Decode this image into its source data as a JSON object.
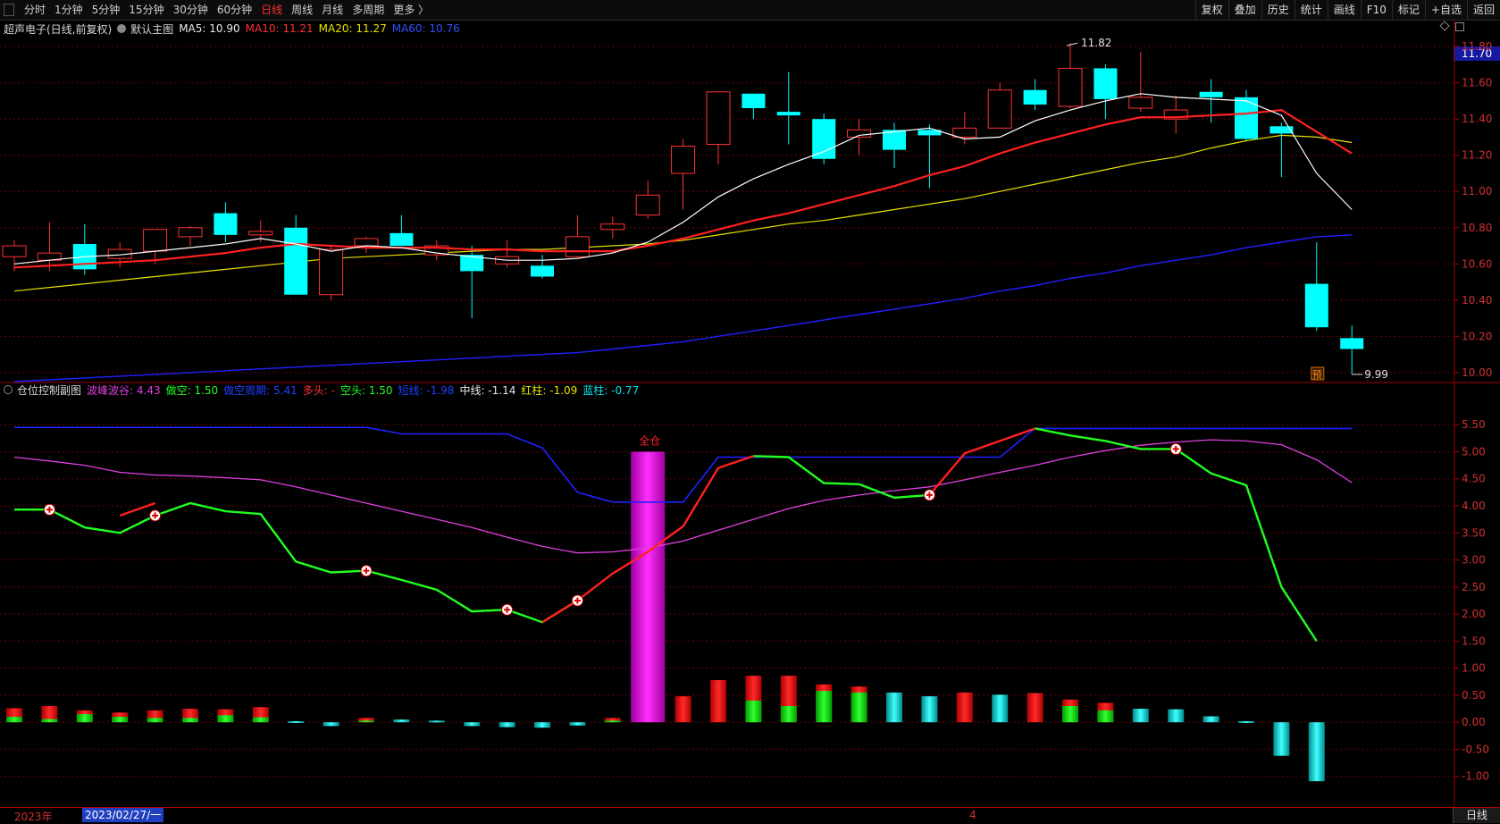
{
  "toolbar": {
    "periods": [
      "分时",
      "1分钟",
      "5分钟",
      "15分钟",
      "30分钟",
      "60分钟",
      "日线",
      "周线",
      "月线",
      "多周期",
      "更多 〉"
    ],
    "active_period": "日线",
    "right_menu": [
      "复权",
      "叠加",
      "历史",
      "统计",
      "画线",
      "F10",
      "标记",
      "+自选",
      "返回"
    ]
  },
  "main_legend": {
    "title": "超声电子(日线,前复权)",
    "template": "默认主图",
    "ma5": "MA5: 10.90",
    "ma10": "MA10: 11.21",
    "ma20": "MA20: 11.27",
    "ma60": "MA60: 10.76"
  },
  "sub_legend": {
    "title": "仓位控制副图",
    "bofeng": "波峰波谷: 4.43",
    "zuokong": "做空: 1.50",
    "zuokong_zhouqi": "做空周期: 5.41",
    "duotou": "多头: -",
    "kongtou": "空头: 1.50",
    "duanxian": "短线: -1.98",
    "zhongxian": "中线: -1.14",
    "hongzhu": "红柱: -1.09",
    "lanzhu": "蓝柱: -0.77"
  },
  "current_price": "11.70",
  "bottom": {
    "year": "2023年",
    "date": "2023/02/27/一",
    "month_mark": "4",
    "period": "日线"
  },
  "colors": {
    "up": "#ff3232",
    "down": "#00ffff",
    "ma5": "#ffffff",
    "ma10": "#ff2020",
    "ma20": "#e8e000",
    "ma60": "#2020ff",
    "grid": "#6a0000"
  },
  "chart_data": [
    {
      "type": "candlestick",
      "title": "超声电子(日线,前复权)",
      "y_ticks": [
        "11.80",
        "11.60",
        "11.40",
        "11.20",
        "11.00",
        "10.80",
        "10.60",
        "10.40",
        "10.20",
        "10.00"
      ],
      "ylim": [
        9.95,
        11.85
      ],
      "annotations": {
        "high": "11.82",
        "low": "9.99",
        "signal_tag": "预"
      },
      "candles": [
        {
          "o": 10.64,
          "h": 10.73,
          "l": 10.56,
          "c": 10.7
        },
        {
          "o": 10.62,
          "h": 10.83,
          "l": 10.56,
          "c": 10.66
        },
        {
          "o": 10.71,
          "h": 10.82,
          "l": 10.54,
          "c": 10.57
        },
        {
          "o": 10.63,
          "h": 10.72,
          "l": 10.58,
          "c": 10.68
        },
        {
          "o": 10.67,
          "h": 10.74,
          "l": 10.6,
          "c": 10.79
        },
        {
          "o": 10.75,
          "h": 10.81,
          "l": 10.7,
          "c": 10.8
        },
        {
          "o": 10.88,
          "h": 10.94,
          "l": 10.72,
          "c": 10.76
        },
        {
          "o": 10.76,
          "h": 10.84,
          "l": 10.72,
          "c": 10.78
        },
        {
          "o": 10.8,
          "h": 10.87,
          "l": 10.43,
          "c": 10.43
        },
        {
          "o": 10.43,
          "h": 10.7,
          "l": 10.4,
          "c": 10.68
        },
        {
          "o": 10.7,
          "h": 10.75,
          "l": 10.66,
          "c": 10.74
        },
        {
          "o": 10.77,
          "h": 10.87,
          "l": 10.7,
          "c": 10.7
        },
        {
          "o": 10.65,
          "h": 10.73,
          "l": 10.62,
          "c": 10.7
        },
        {
          "o": 10.65,
          "h": 10.7,
          "l": 10.3,
          "c": 10.56
        },
        {
          "o": 10.6,
          "h": 10.73,
          "l": 10.58,
          "c": 10.64
        },
        {
          "o": 10.59,
          "h": 10.65,
          "l": 10.52,
          "c": 10.53
        },
        {
          "o": 10.64,
          "h": 10.87,
          "l": 10.63,
          "c": 10.75
        },
        {
          "o": 10.79,
          "h": 10.86,
          "l": 10.74,
          "c": 10.82
        },
        {
          "o": 10.87,
          "h": 11.06,
          "l": 10.85,
          "c": 10.98
        },
        {
          "o": 11.1,
          "h": 11.29,
          "l": 10.9,
          "c": 11.25
        },
        {
          "o": 11.26,
          "h": 11.55,
          "l": 11.15,
          "c": 11.55
        },
        {
          "o": 11.54,
          "h": 11.54,
          "l": 11.4,
          "c": 11.46
        },
        {
          "o": 11.44,
          "h": 11.66,
          "l": 11.26,
          "c": 11.42
        },
        {
          "o": 11.4,
          "h": 11.43,
          "l": 11.15,
          "c": 11.18
        },
        {
          "o": 11.3,
          "h": 11.4,
          "l": 11.2,
          "c": 11.34
        },
        {
          "o": 11.34,
          "h": 11.38,
          "l": 11.13,
          "c": 11.23
        },
        {
          "o": 11.34,
          "h": 11.37,
          "l": 11.02,
          "c": 11.31
        },
        {
          "o": 11.3,
          "h": 11.44,
          "l": 11.26,
          "c": 11.35
        },
        {
          "o": 11.35,
          "h": 11.6,
          "l": 11.35,
          "c": 11.56
        },
        {
          "o": 11.56,
          "h": 11.62,
          "l": 11.45,
          "c": 11.48
        },
        {
          "o": 11.47,
          "h": 11.82,
          "l": 11.46,
          "c": 11.68
        },
        {
          "o": 11.68,
          "h": 11.7,
          "l": 11.4,
          "c": 11.51
        },
        {
          "o": 11.46,
          "h": 11.77,
          "l": 11.44,
          "c": 11.52
        },
        {
          "o": 11.4,
          "h": 11.53,
          "l": 11.32,
          "c": 11.45
        },
        {
          "o": 11.55,
          "h": 11.62,
          "l": 11.38,
          "c": 11.52
        },
        {
          "o": 11.52,
          "h": 11.56,
          "l": 11.28,
          "c": 11.29
        },
        {
          "o": 11.36,
          "h": 11.38,
          "l": 11.08,
          "c": 11.32
        },
        {
          "o": 10.49,
          "h": 10.72,
          "l": 10.23,
          "c": 10.25
        },
        {
          "o": 10.19,
          "h": 10.26,
          "l": 9.99,
          "c": 10.13
        }
      ],
      "ma5": [
        10.6,
        10.62,
        10.64,
        10.65,
        10.67,
        10.69,
        10.71,
        10.74,
        10.71,
        10.67,
        10.7,
        10.69,
        10.66,
        10.64,
        10.62,
        10.62,
        10.63,
        10.66,
        10.72,
        10.83,
        10.97,
        11.07,
        11.15,
        11.22,
        11.31,
        11.33,
        11.35,
        11.29,
        11.3,
        11.39,
        11.45,
        11.5,
        11.54,
        11.52,
        11.51,
        11.5,
        11.42,
        11.1,
        10.9
      ],
      "ma10": [
        10.58,
        10.59,
        10.6,
        10.61,
        10.62,
        10.64,
        10.66,
        10.69,
        10.71,
        10.7,
        10.69,
        10.69,
        10.69,
        10.68,
        10.68,
        10.67,
        10.67,
        10.67,
        10.7,
        10.74,
        10.79,
        10.84,
        10.88,
        10.93,
        10.98,
        11.03,
        11.09,
        11.14,
        11.21,
        11.27,
        11.32,
        11.37,
        11.41,
        11.41,
        11.42,
        11.43,
        11.45,
        11.33,
        11.21
      ],
      "ma20": [
        10.45,
        10.47,
        10.49,
        10.51,
        10.53,
        10.55,
        10.57,
        10.59,
        10.61,
        10.63,
        10.64,
        10.65,
        10.66,
        10.67,
        10.68,
        10.68,
        10.69,
        10.7,
        10.71,
        10.73,
        10.76,
        10.79,
        10.82,
        10.84,
        10.87,
        10.9,
        10.93,
        10.96,
        11.0,
        11.04,
        11.08,
        11.12,
        11.16,
        11.19,
        11.24,
        11.28,
        11.31,
        11.3,
        11.27
      ],
      "ma60": [
        9.95,
        9.96,
        9.97,
        9.98,
        9.99,
        10.0,
        10.01,
        10.02,
        10.03,
        10.04,
        10.05,
        10.06,
        10.07,
        10.08,
        10.09,
        10.1,
        10.11,
        10.13,
        10.15,
        10.17,
        10.2,
        10.23,
        10.26,
        10.29,
        10.32,
        10.35,
        10.38,
        10.41,
        10.45,
        10.48,
        10.52,
        10.55,
        10.59,
        10.62,
        10.65,
        10.69,
        10.72,
        10.75,
        10.76
      ]
    },
    {
      "type": "line",
      "title": "仓位控制副图",
      "y_ticks": [
        "5.50",
        "5.00",
        "4.50",
        "4.00",
        "3.50",
        "3.00",
        "2.50",
        "2.00",
        "1.50",
        "1.00",
        "0.50",
        "0.00",
        "-0.50",
        "-1.00"
      ],
      "ylim": [
        -1.55,
        5.85
      ],
      "annotation_label": "全仓",
      "annotation_bar": {
        "index": 18,
        "value": 5.0
      },
      "series": [
        {
          "name": "做空周期",
          "color": "#2020ff",
          "values": [
            5.45,
            5.45,
            5.45,
            5.45,
            5.45,
            5.45,
            5.45,
            5.45,
            5.45,
            5.45,
            5.45,
            5.33,
            5.33,
            5.33,
            5.33,
            5.07,
            4.25,
            4.07,
            4.07,
            4.07,
            4.9,
            4.9,
            4.9,
            4.9,
            4.9,
            4.9,
            4.9,
            4.9,
            4.9,
            5.43,
            5.43,
            5.43,
            5.43,
            5.43,
            5.43,
            5.43,
            5.43,
            5.43,
            5.43
          ]
        },
        {
          "name": "波峰波谷",
          "color": "#e040e0",
          "values": [
            4.9,
            4.83,
            4.75,
            4.62,
            4.57,
            4.55,
            4.52,
            4.48,
            4.35,
            4.2,
            4.05,
            3.9,
            3.75,
            3.6,
            3.42,
            3.25,
            3.13,
            3.15,
            3.22,
            3.35,
            3.55,
            3.75,
            3.95,
            4.1,
            4.2,
            4.28,
            4.35,
            4.48,
            4.62,
            4.75,
            4.9,
            5.02,
            5.12,
            5.18,
            5.22,
            5.2,
            5.13,
            4.85,
            4.43
          ]
        },
        {
          "name": "多头",
          "color": "#ff2020",
          "values": [
            null,
            null,
            null,
            3.82,
            4.05,
            null,
            null,
            null,
            null,
            null,
            null,
            null,
            null,
            null,
            null,
            1.85,
            2.25,
            2.75,
            3.15,
            3.62,
            4.7,
            4.92,
            null,
            null,
            null,
            null,
            4.2,
            4.97,
            5.2,
            5.43,
            null,
            null,
            null,
            null,
            null,
            null,
            null,
            null,
            null
          ]
        },
        {
          "name": "空头",
          "color": "#20ff20",
          "values": [
            3.93,
            3.93,
            3.6,
            3.5,
            3.82,
            4.05,
            3.9,
            3.85,
            2.97,
            2.77,
            2.8,
            2.63,
            2.45,
            2.05,
            2.08,
            1.85,
            2.25,
            null,
            null,
            null,
            null,
            4.92,
            4.9,
            4.42,
            4.4,
            4.15,
            4.2,
            null,
            null,
            5.43,
            5.3,
            5.2,
            5.05,
            5.05,
            4.6,
            4.38,
            2.5,
            1.5,
            null
          ]
        },
        {
          "name": "红柱",
          "color": "#ff2020",
          "values": [
            0.26,
            0.3,
            0.22,
            0.18,
            0.22,
            0.25,
            0.24,
            0.28,
            0.02,
            -0.07,
            0.08,
            0.05,
            0.03,
            -0.07,
            -0.09,
            -0.1,
            -0.06,
            0.08,
            5.0,
            0.48,
            0.78,
            0.86,
            0.86,
            0.7,
            0.66,
            0.55,
            0.48,
            0.55,
            0.51,
            0.54,
            0.42,
            0.36,
            0.25,
            0.24,
            0.11,
            0.02,
            -0.62,
            -1.09,
            null
          ]
        },
        {
          "name": "蓝柱",
          "color": "#00e5e5",
          "values": [
            0.1,
            0.06,
            0.15,
            0.1,
            0.08,
            0.08,
            0.13,
            0.09,
            0.02,
            -0.06,
            0.03,
            0.04,
            0.02,
            -0.06,
            -0.09,
            -0.08,
            -0.05,
            0.03,
            0.0,
            0.0,
            0.0,
            0.4,
            0.3,
            0.58,
            0.55,
            0.55,
            0.48,
            0.0,
            0.5,
            0.0,
            0.3,
            0.22,
            0.25,
            0.24,
            0.1,
            0.02,
            -0.62,
            -0.77,
            null
          ]
        }
      ],
      "signals_plus": [
        1,
        4,
        10,
        14,
        16,
        26,
        33
      ]
    }
  ]
}
